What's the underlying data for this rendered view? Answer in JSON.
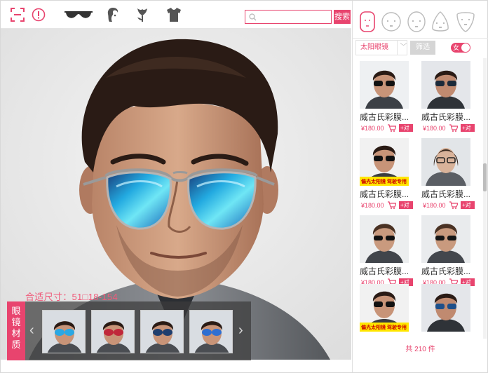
{
  "colors": {
    "accent": "#e8446e",
    "text": "#333333"
  },
  "toolbar": {
    "icons": [
      "scan-icon",
      "alert-icon",
      "sunglasses-icon",
      "hair-icon",
      "tulip-icon",
      "shirt-icon"
    ],
    "search_placeholder": "",
    "search_label": "搜索"
  },
  "stage": {
    "fit_size_label": "合适尺寸：51□18-154"
  },
  "strip": {
    "material_tab": "眼镜材质",
    "prev": "‹",
    "next": "›"
  },
  "panel": {
    "face_shapes": [
      "face-shape-long",
      "face-shape-round",
      "face-shape-oval",
      "face-shape-triangle",
      "face-shape-inverted-triangle"
    ],
    "category": "太阳眼镜",
    "category_arrow": "﹀",
    "filter_label": "筛选",
    "gender_label": "女",
    "products": [
      {
        "name": "威古氏彩膜...",
        "price": "¥180.00",
        "compare": "+对比",
        "promo": ""
      },
      {
        "name": "威古氏彩膜...",
        "price": "¥180.00",
        "compare": "+对比",
        "promo": ""
      },
      {
        "name": "威古氏彩膜...",
        "price": "¥180.00",
        "compare": "+对比",
        "promo": "偏光太阳镜 驾驶专用"
      },
      {
        "name": "威古氏彩膜...",
        "price": "¥180.00",
        "compare": "+对比",
        "promo": ""
      },
      {
        "name": "威古氏彩膜...",
        "price": "¥180.00",
        "compare": "+对比",
        "promo": ""
      },
      {
        "name": "威古氏彩膜...",
        "price": "¥180.00",
        "compare": "+对比",
        "promo": ""
      },
      {
        "name": "",
        "price": "",
        "compare": "",
        "promo": "偏光太阳镜 驾驶专用"
      },
      {
        "name": "",
        "price": "",
        "compare": "",
        "promo": ""
      }
    ],
    "total": "共 210 件"
  }
}
